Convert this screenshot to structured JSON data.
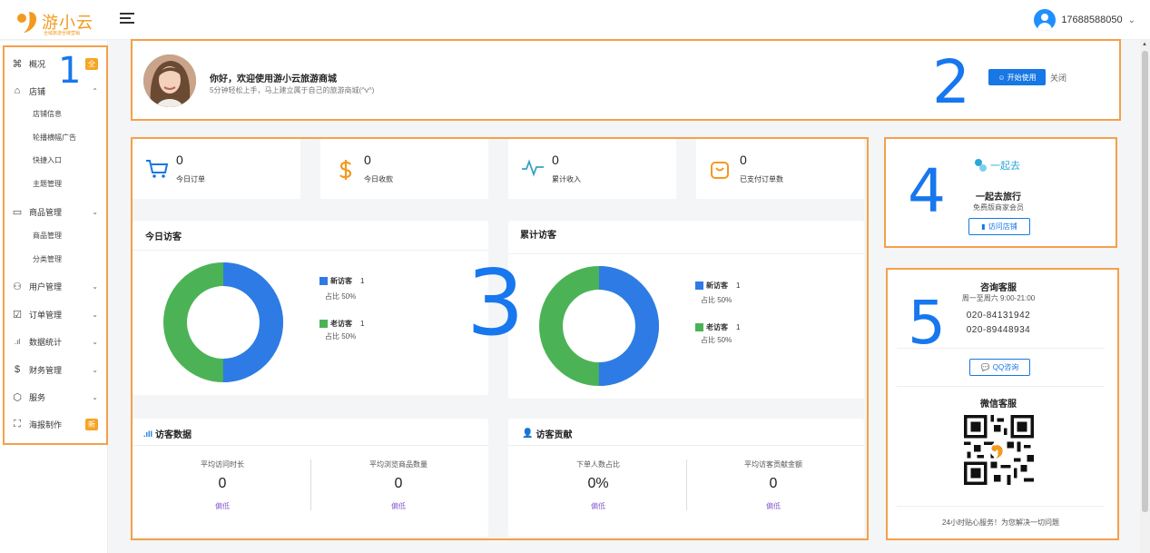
{
  "header": {
    "logo_text": "游小云",
    "logo_tagline": "全域旅游全链营销",
    "user_phone": "17688588050"
  },
  "sidebar": {
    "items": [
      {
        "label": "概况",
        "icon": "command-icon",
        "badge": "全"
      },
      {
        "label": "店铺",
        "icon": "home-icon",
        "arrow": "⌃"
      },
      {
        "label": "商品管理",
        "icon": "calendar-icon",
        "arrow": "⌄"
      },
      {
        "label": "用户管理",
        "icon": "users-icon",
        "arrow": "⌄"
      },
      {
        "label": "订单管理",
        "icon": "checkbox-icon",
        "arrow": "⌄"
      },
      {
        "label": "数据统计",
        "icon": "bar-chart-icon",
        "arrow": "⌄"
      },
      {
        "label": "财务管理",
        "icon": "dollar-icon",
        "arrow": "⌄"
      },
      {
        "label": "服务",
        "icon": "cube-icon",
        "arrow": "⌄"
      },
      {
        "label": "海报制作",
        "icon": "map-icon",
        "badge": "新"
      }
    ],
    "shop_sub": [
      "店铺信息",
      "轮播横幅广告",
      "快捷入口",
      "主题管理"
    ],
    "product_sub": [
      "商品管理",
      "分类管理"
    ]
  },
  "annotations": [
    "1",
    "2",
    "3",
    "4",
    "5"
  ],
  "welcome": {
    "title": "你好，欢迎使用游小云旅游商城",
    "subtitle": "5分钟轻松上手，马上建立属于自己的旅游商城(^v^)",
    "start_label": "开始使用",
    "close_label": "关闭"
  },
  "stats": [
    {
      "value": "0",
      "label": "今日订单",
      "icon": "cart-icon"
    },
    {
      "value": "0",
      "label": "今日收款",
      "icon": "dollar-icon"
    },
    {
      "value": "0",
      "label": "累计收入",
      "icon": "pulse-icon"
    },
    {
      "value": "0",
      "label": "已支付订单数",
      "icon": "bag-icon"
    }
  ],
  "colors": {
    "new_visitor": "#2e7be6",
    "old_visitor": "#4bb356",
    "accent": "#1677e5",
    "highlight": "#f5a04b"
  },
  "today_visitors": {
    "title": "今日访客",
    "new_label": "新访客",
    "new_count": "1",
    "new_pct": "占比 50%",
    "old_label": "老访客",
    "old_count": "1",
    "old_pct": "占比 50%",
    "new_share": 0.5
  },
  "total_visitors": {
    "title": "累计访客",
    "new_label": "新访客",
    "new_count": "1",
    "new_pct": "占比 50%",
    "old_label": "老访客",
    "old_count": "1",
    "old_pct": "占比 50%",
    "new_share": 0.5
  },
  "visitor_data": {
    "title": "访客数据",
    "metrics": [
      {
        "label": "平均访问时长",
        "value": "0",
        "level": "偏低"
      },
      {
        "label": "平均浏览商品数量",
        "value": "0",
        "level": "偏低"
      }
    ]
  },
  "visitor_contribution": {
    "title": "访客贡献",
    "metrics": [
      {
        "label": "下单人数占比",
        "value": "0%",
        "level": "偏低"
      },
      {
        "label": "平均访客贡献金额",
        "value": "0",
        "level": "偏低"
      }
    ]
  },
  "shop_card": {
    "logo_text": "一起去",
    "name": "一起去旅行",
    "level": "免费版商家会员",
    "visit_label": "访问店铺"
  },
  "service": {
    "title": "咨询客服",
    "hours": "周一至周六 9:00-21:00",
    "phone1": "020-84131942",
    "phone2": "020-89448934",
    "qq_label": "QQ咨询",
    "wechat_title": "微信客服",
    "footer": "24小时贴心服务！为您解决一切问题"
  }
}
